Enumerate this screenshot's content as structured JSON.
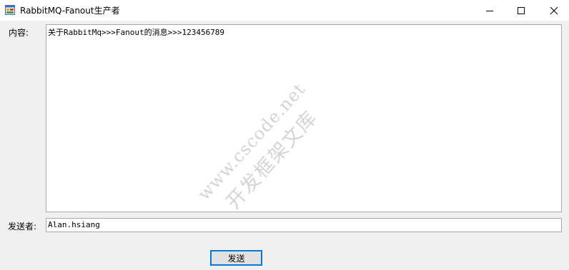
{
  "window": {
    "title": "RabbitMQ-Fanout生产者",
    "icon": "app-form-icon",
    "controls": [
      "minimize-icon",
      "maximize-icon",
      "close-icon"
    ]
  },
  "form": {
    "content_label": "内容:",
    "content_value": "关于RabbitMq>>>Fanout的消息>>>123456789",
    "sender_label": "发送者:",
    "sender_value": "Alan.hsiang",
    "send_button_label": "发送"
  },
  "watermark": {
    "line1": "www.cscode.net",
    "line2": "开发框架文库"
  },
  "colors": {
    "focus_border": "#0078d7",
    "window_bg": "#f0f0f0",
    "titlebar_bg": "#ffffff"
  }
}
